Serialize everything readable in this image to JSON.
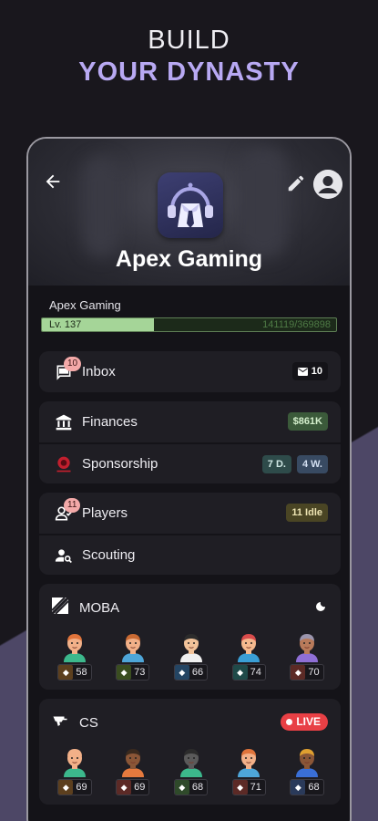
{
  "promo": {
    "line1": "BUILD",
    "line2": "YOUR DYNASTY"
  },
  "team": {
    "name": "Apex Gaming",
    "level_label": "Apex Gaming",
    "level_text": "Lv. 137",
    "xp_text": "141119/369898",
    "xp_fraction": 0.3815
  },
  "menu": {
    "inbox": {
      "label": "Inbox",
      "badge": "10",
      "mail_count": "10"
    },
    "finances": {
      "label": "Finances",
      "amount": "$861K"
    },
    "sponsorship": {
      "label": "Sponsorship",
      "pill1": "7 D.",
      "pill2": "4 W."
    },
    "players": {
      "label": "Players",
      "badge": "11",
      "status": "11 Idle"
    },
    "scouting": {
      "label": "Scouting"
    }
  },
  "games": [
    {
      "name": "MOBA",
      "status_icon": "moon-icon",
      "players": [
        {
          "rating": "58",
          "role_color": "#5c3f1e",
          "skin": "#f2b088",
          "hair": "#e0743b",
          "shirt": "#3cb88c"
        },
        {
          "rating": "73",
          "role_color": "#3a4d20",
          "skin": "#f2b088",
          "hair": "#c96a33",
          "shirt": "#4ea6d9"
        },
        {
          "rating": "66",
          "role_color": "#244563",
          "skin": "#f2c39a",
          "hair": "#2c2c2c",
          "shirt": "#f0f0f0"
        },
        {
          "rating": "74",
          "role_color": "#1f4a49",
          "skin": "#f4b98e",
          "hair": "#d94c4c",
          "shirt": "#3a9fd6"
        },
        {
          "rating": "70",
          "role_color": "#5c2a26",
          "skin": "#b87a5a",
          "hair": "#9b95ad",
          "shirt": "#8f6fd6"
        }
      ]
    },
    {
      "name": "CS",
      "live_label": "LIVE",
      "players": [
        {
          "rating": "69",
          "role_color": "#5c3f1e",
          "skin": "#f2b088",
          "hair": "#f2b088",
          "shirt": "#3cb88c"
        },
        {
          "rating": "69",
          "role_color": "#5c2a26",
          "skin": "#8a5637",
          "hair": "#3a2a1e",
          "shirt": "#e67a3e"
        },
        {
          "rating": "68",
          "role_color": "#2f4a2a",
          "skin": "#5a5a5a",
          "hair": "#2c2c2c",
          "shirt": "#3cb88c"
        },
        {
          "rating": "71",
          "role_color": "#5c2a26",
          "skin": "#f2b088",
          "hair": "#e0743b",
          "shirt": "#4ea6d9"
        },
        {
          "rating": "68",
          "role_color": "#2a3a5a",
          "skin": "#8a5637",
          "hair": "#e0a030",
          "shirt": "#3a6fd6"
        }
      ]
    }
  ]
}
